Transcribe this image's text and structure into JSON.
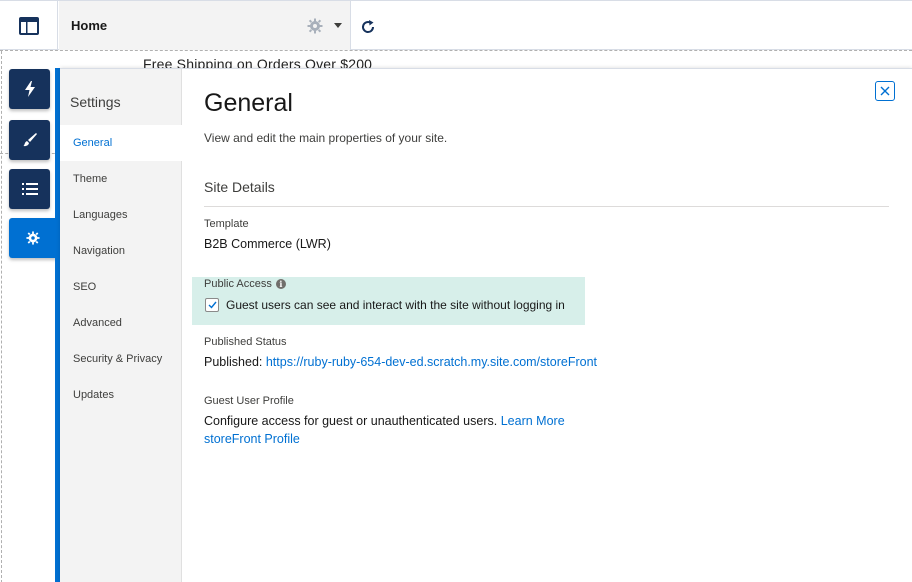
{
  "topbar": {
    "page_label": "Home"
  },
  "canvas": {
    "banner_text": "Free Shipping on Orders Over $200"
  },
  "rail": {
    "items": [
      {
        "icon": "lightning-icon"
      },
      {
        "icon": "brush-icon"
      },
      {
        "icon": "list-icon"
      },
      {
        "icon": "gear-icon",
        "active": true
      }
    ]
  },
  "settings": {
    "nav_title": "Settings",
    "nav_items": [
      {
        "label": "General",
        "active": true
      },
      {
        "label": "Theme"
      },
      {
        "label": "Languages"
      },
      {
        "label": "Navigation"
      },
      {
        "label": "SEO"
      },
      {
        "label": "Advanced"
      },
      {
        "label": "Security & Privacy"
      },
      {
        "label": "Updates"
      }
    ],
    "title": "General",
    "description": "View and edit the main properties of your site.",
    "section_title": "Site Details",
    "template_label": "Template",
    "template_value": "B2B Commerce (LWR)",
    "public_access_label": "Public Access",
    "public_access_checkbox_label": "Guest users can see and interact with the site without logging in",
    "public_access_checked": true,
    "published_status_label": "Published Status",
    "published_prefix": "Published: ",
    "published_url": "https://ruby-ruby-654-dev-ed.scratch.my.site.com/storeFront",
    "guest_profile_label": "Guest User Profile",
    "guest_profile_text": "Configure access for guest or unauthenticated users.",
    "learn_more": "Learn More",
    "profile_link": "storeFront Profile"
  },
  "colors": {
    "accent": "#0070d2",
    "rail_dark": "#16325c",
    "highlight": "#d7efea"
  }
}
